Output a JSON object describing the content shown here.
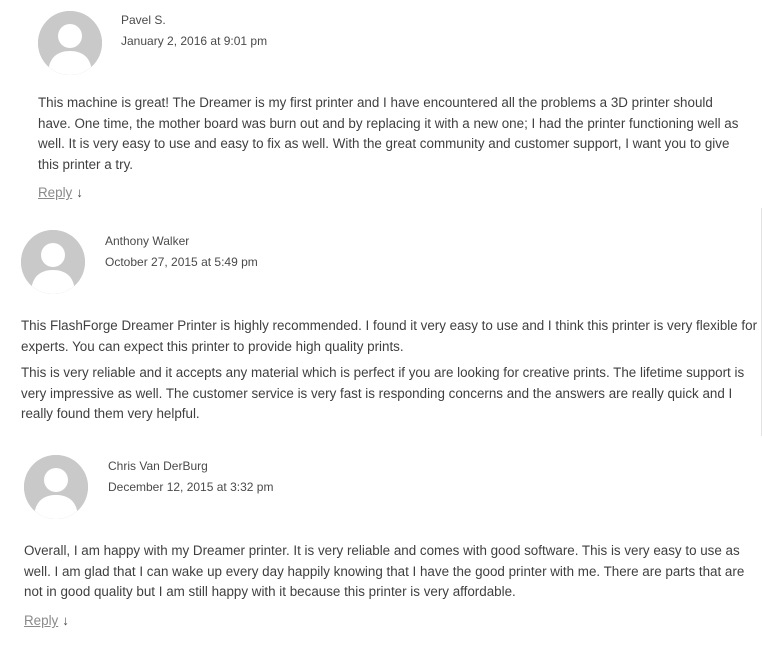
{
  "comments": [
    {
      "author": "Pavel S.",
      "date": "January 2, 2016 at 9:01 pm",
      "paragraphs": [
        "This machine is great! The Dreamer is my first printer and I have encountered all the problems a 3D printer should have. One time, the mother board was burn out and by replacing it with a new one; I had the printer functioning well as well. It is very easy to use and easy to fix as well. With the great community and customer support, I want you to give this printer a try."
      ],
      "reply_label": "Reply",
      "reply_arrow": "↓"
    },
    {
      "author": "Anthony Walker",
      "date": "October 27, 2015 at 5:49 pm",
      "paragraphs": [
        "This FlashForge Dreamer Printer is highly recommended. I found it very easy to use and I think this printer is very flexible for experts. You can expect this printer to provide high quality prints.",
        "This is very reliable and it accepts any material which is perfect if you are looking for creative prints. The lifetime support is very impressive as well. The customer service is very fast is responding concerns and the answers are really quick and I really found them very helpful."
      ]
    },
    {
      "author": "Chris Van DerBurg",
      "date": "December 12, 2015 at 3:32 pm",
      "paragraphs": [
        "Overall, I am happy with my Dreamer printer. It is very reliable and comes with good software. This is very easy to use as well. I am glad that I can wake up every day happily knowing that I have the good printer with me. There are parts that are not in good quality but I am still happy with it because this printer is very affordable."
      ],
      "reply_label": "Reply",
      "reply_arrow": "↓"
    }
  ],
  "colors": {
    "avatar_bg": "#c9c9c9",
    "avatar_fg": "#ffffff",
    "text": "#3f3f3f",
    "reply_link": "#8a8a8a"
  },
  "icons": {
    "avatar": "default-avatar-icon",
    "reply_arrow": "down-arrow-icon"
  }
}
